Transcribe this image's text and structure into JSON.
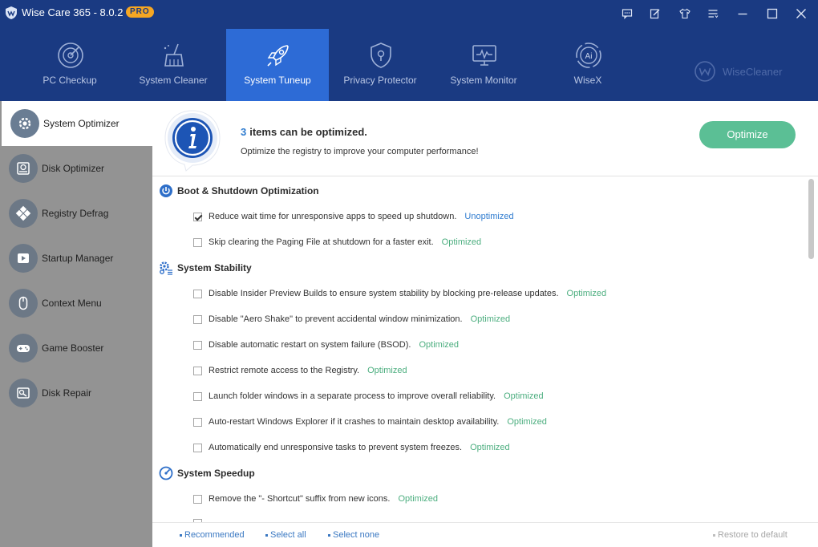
{
  "window": {
    "title": "Wise Care 365 - 8.0.2",
    "badge": "PRO"
  },
  "nav": {
    "tabs": [
      {
        "label": "PC Checkup",
        "icon": "radar-icon"
      },
      {
        "label": "System Cleaner",
        "icon": "broom-icon"
      },
      {
        "label": "System Tuneup",
        "icon": "rocket-icon"
      },
      {
        "label": "Privacy Protector",
        "icon": "shield-icon"
      },
      {
        "label": "System Monitor",
        "icon": "monitor-icon"
      },
      {
        "label": "WiseX",
        "icon": "ai-icon"
      }
    ],
    "active_tab": "System Tuneup",
    "brand": "WiseCleaner"
  },
  "sidebar": {
    "items": [
      {
        "label": "System Optimizer",
        "icon": "gear-icon"
      },
      {
        "label": "Disk Optimizer",
        "icon": "disk-icon"
      },
      {
        "label": "Registry Defrag",
        "icon": "registry-icon"
      },
      {
        "label": "Startup Manager",
        "icon": "play-icon"
      },
      {
        "label": "Context Menu",
        "icon": "mouse-icon"
      },
      {
        "label": "Game Booster",
        "icon": "gamepad-icon"
      },
      {
        "label": "Disk Repair",
        "icon": "disk-repair-icon"
      }
    ],
    "active_item": "System Optimizer"
  },
  "summary": {
    "count": "3",
    "count_text": "items can be optimized.",
    "subtitle": "Optimize the registry to improve your computer performance!",
    "optimize_label": "Optimize"
  },
  "sections": [
    {
      "title": "Boot & Shutdown Optimization",
      "icon": "power-icon",
      "items": [
        {
          "text": "Reduce wait time for unresponsive apps to speed up shutdown.",
          "status": "Unoptimized",
          "checked": true
        },
        {
          "text": "Skip clearing the Paging File at shutdown for a faster exit.",
          "status": "Optimized",
          "checked": false
        }
      ]
    },
    {
      "title": "System Stability",
      "icon": "gears-icon",
      "items": [
        {
          "text": "Disable Insider Preview Builds to ensure system stability by blocking pre-release updates.",
          "status": "Optimized",
          "checked": false
        },
        {
          "text": "Disable \"Aero Shake\" to prevent accidental window minimization.",
          "status": "Optimized",
          "checked": false
        },
        {
          "text": "Disable automatic restart on system failure (BSOD).",
          "status": "Optimized",
          "checked": false
        },
        {
          "text": "Restrict remote access to the Registry.",
          "status": "Optimized",
          "checked": false
        },
        {
          "text": "Launch folder windows in a separate process to improve overall reliability.",
          "status": "Optimized",
          "checked": false
        },
        {
          "text": "Auto-restart Windows Explorer if it crashes to maintain desktop availability.",
          "status": "Optimized",
          "checked": false
        },
        {
          "text": "Automatically end unresponsive tasks to prevent system freezes.",
          "status": "Optimized",
          "checked": false
        }
      ]
    },
    {
      "title": "System Speedup",
      "icon": "speedometer-icon",
      "items": [
        {
          "text": "Remove the \"- Shortcut\" suffix from new icons.",
          "status": "Optimized",
          "checked": false
        }
      ]
    }
  ],
  "footer": {
    "recommended": "Recommended",
    "select_all": "Select all",
    "select_none": "Select none",
    "restore": "Restore to default"
  }
}
